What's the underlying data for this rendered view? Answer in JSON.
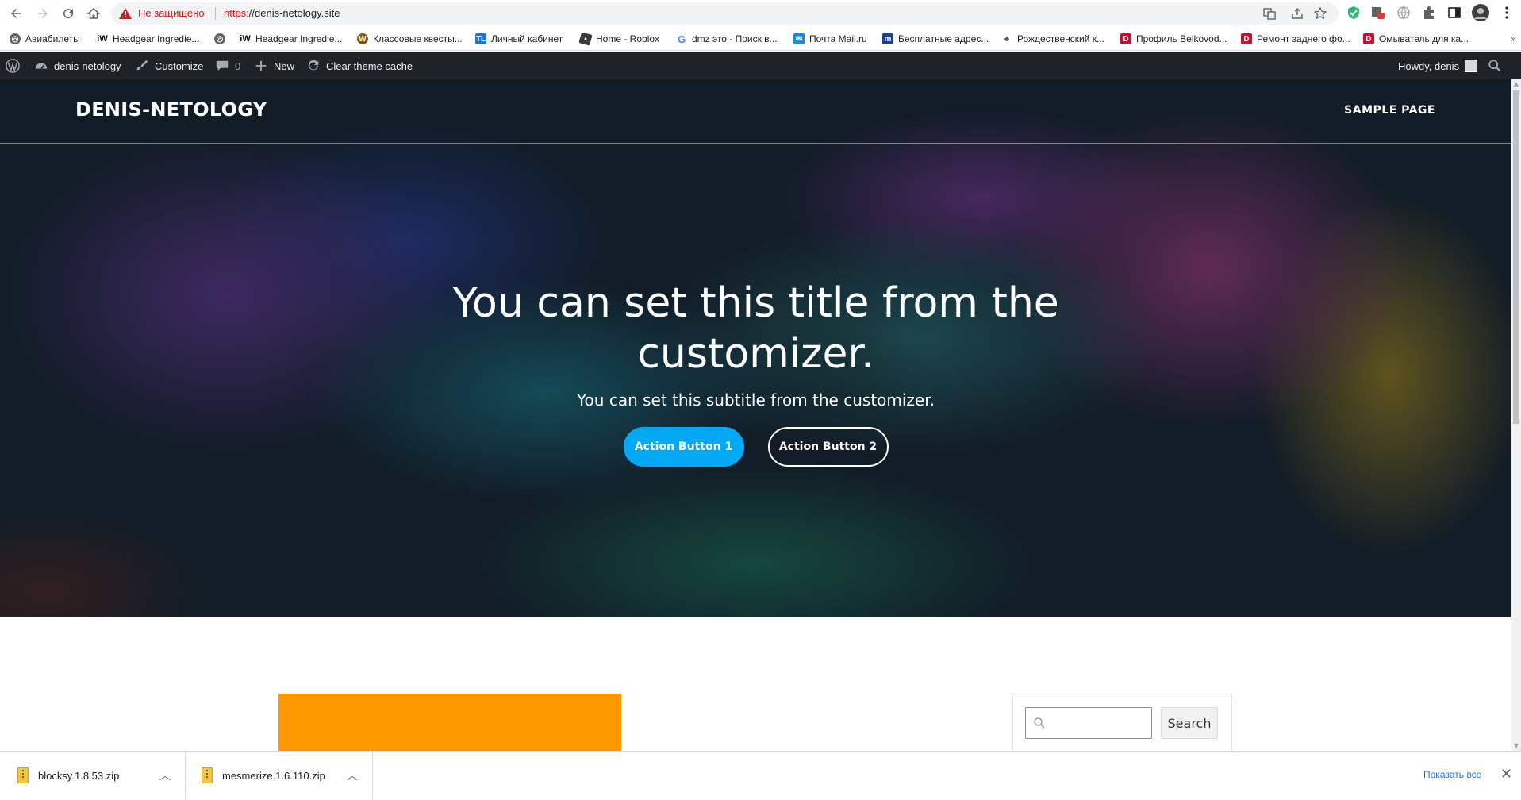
{
  "browser": {
    "insecure_label": "Не защищено",
    "url_scheme": "https",
    "url_rest": "://denis-netology.site",
    "bookmarks": [
      {
        "label": "Авиабилеты",
        "icon": "globe-icon",
        "color": "#5f6368"
      },
      {
        "label": "Headgear Ingredie...",
        "icon": "iw-icon",
        "color": "#000000"
      },
      {
        "label": "",
        "icon": "globe-icon",
        "color": "#5f6368"
      },
      {
        "label": "Headgear Ingredie...",
        "icon": "iw-icon",
        "color": "#000000"
      },
      {
        "label": "Классовые квесты...",
        "icon": "wow-icon",
        "color": "#8b5a00"
      },
      {
        "label": "Личный кабинет",
        "icon": "tl-icon",
        "color": "#1a73e8"
      },
      {
        "label": "Home - Roblox",
        "icon": "roblox-icon",
        "color": "#393b3d"
      },
      {
        "label": "dmz это - Поиск в...",
        "icon": "google-icon",
        "color": "#4285f4"
      },
      {
        "label": "Почта Mail.ru",
        "icon": "mail-icon",
        "color": "#168de2"
      },
      {
        "label": "Бесплатные адрес...",
        "icon": "m-icon",
        "color": "#1a3fa0"
      },
      {
        "label": "Рождественский к...",
        "icon": "bird-icon",
        "color": "#555555"
      },
      {
        "label": "Профиль Belkovod...",
        "icon": "d-icon",
        "color": "#c4122f"
      },
      {
        "label": "Ремонт заднего фо...",
        "icon": "d-icon",
        "color": "#c4122f"
      },
      {
        "label": "Омыватель для ка...",
        "icon": "d-icon",
        "color": "#c4122f"
      }
    ],
    "bookmarks_overflow": "»"
  },
  "adminbar": {
    "site_name": "denis-netology",
    "customize": "Customize",
    "comments_count": "0",
    "new_label": "New",
    "clear_cache": "Clear theme cache",
    "howdy": "Howdy, denis"
  },
  "hero": {
    "site_title": "DENIS-NETOLOGY",
    "nav_item": "SAMPLE PAGE",
    "title": "You can set this title from the customizer.",
    "subtitle": "You can set this subtitle from the customizer.",
    "button1": "Action Button 1",
    "button2": "Action Button 2",
    "accent_color": "#03a9f4"
  },
  "sidebar": {
    "search_placeholder": "",
    "search_button": "Search"
  },
  "content": {
    "block_color": "#ff9800"
  },
  "downloads": {
    "items": [
      {
        "name": "blocksy.1.8.53.zip"
      },
      {
        "name": "mesmerize.1.6.110.zip"
      }
    ],
    "show_all": "Показать все"
  }
}
